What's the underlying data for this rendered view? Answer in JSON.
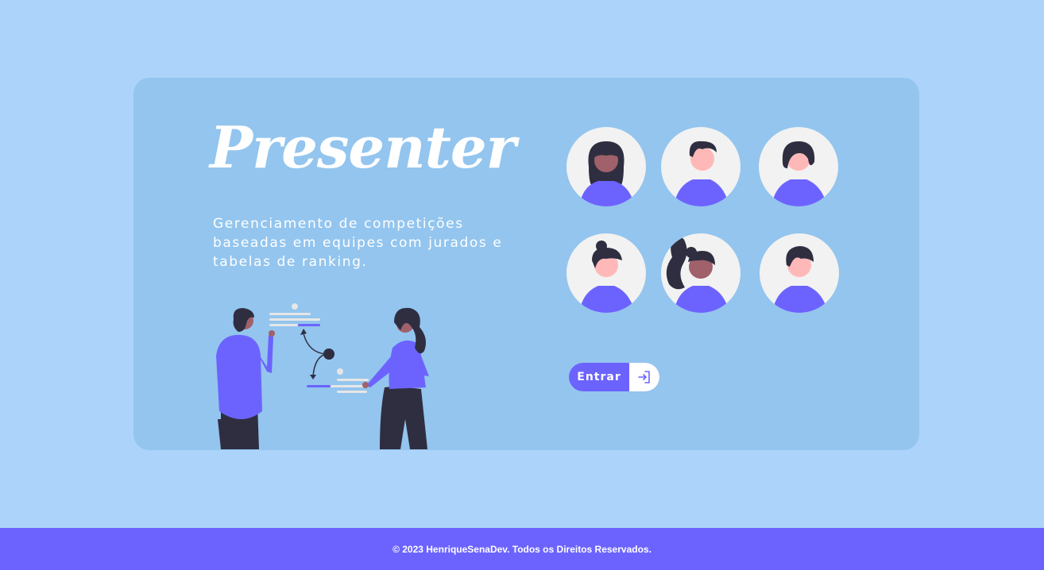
{
  "brand": {
    "logo_text": "Presenter"
  },
  "hero": {
    "tagline": "Gerenciamento de competições baseadas em equipes com jurados e tabelas de ranking."
  },
  "actions": {
    "enter_label": "Entrar",
    "enter_icon": "login-icon"
  },
  "footer": {
    "copyright": "© 2023 HenriqueSenaDev. Todos os Direitos Reservados."
  },
  "colors": {
    "page_bg": "#acd3f9",
    "card_bg": "#93c5ee",
    "accent": "#6c63ff",
    "avatar_bg": "#f2f2f2",
    "hair": "#2f2e41",
    "skin_light": "#ffb8b8",
    "skin_dark": "#a0616a"
  },
  "illustrations": {
    "hero": "team-presentation-illustration",
    "avatars": [
      "avatar-woman-long-hair",
      "avatar-man-short-hair",
      "avatar-woman-bob-hair",
      "avatar-man-bun",
      "avatar-woman-ponytail",
      "avatar-man-topknot"
    ]
  }
}
